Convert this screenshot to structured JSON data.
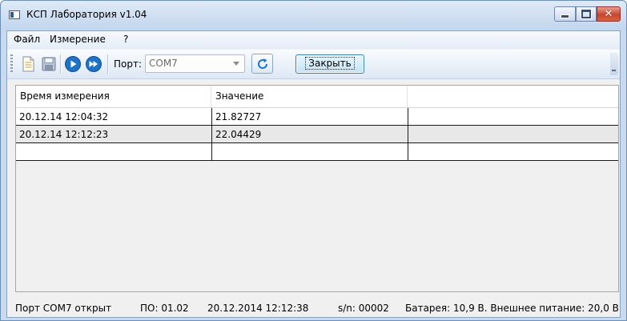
{
  "window": {
    "title": "КСП Лаборатория v1.04"
  },
  "menu": {
    "items": [
      "Файл",
      "Измерение",
      "?"
    ]
  },
  "toolbar": {
    "port_label": "Порт:",
    "port_value": "COM7",
    "close_button_label": "Закрыть",
    "icons": [
      "new-document-icon",
      "save-icon",
      "play-icon",
      "fast-forward-icon",
      "refresh-icon"
    ]
  },
  "grid": {
    "columns": [
      "Время измерения",
      "Значение",
      ""
    ],
    "rows": [
      [
        "20.12.14 12:04:32",
        "21.82727",
        ""
      ],
      [
        "20.12.14 12:12:23",
        "22.04429",
        ""
      ],
      [
        "",
        "",
        ""
      ]
    ]
  },
  "status": {
    "port": "Порт COM7 открыт",
    "firmware": "ПО: 01.02",
    "datetime": "20.12.2014 12:12:38",
    "serial": "s/n: 00002",
    "power": "Батарея: 10,9 В. Внешнее питание: 20,0 В"
  },
  "colors": {
    "window_frame": "#c9daee",
    "close_button": "#c6452d",
    "accent_blue": "#1e73c8"
  }
}
